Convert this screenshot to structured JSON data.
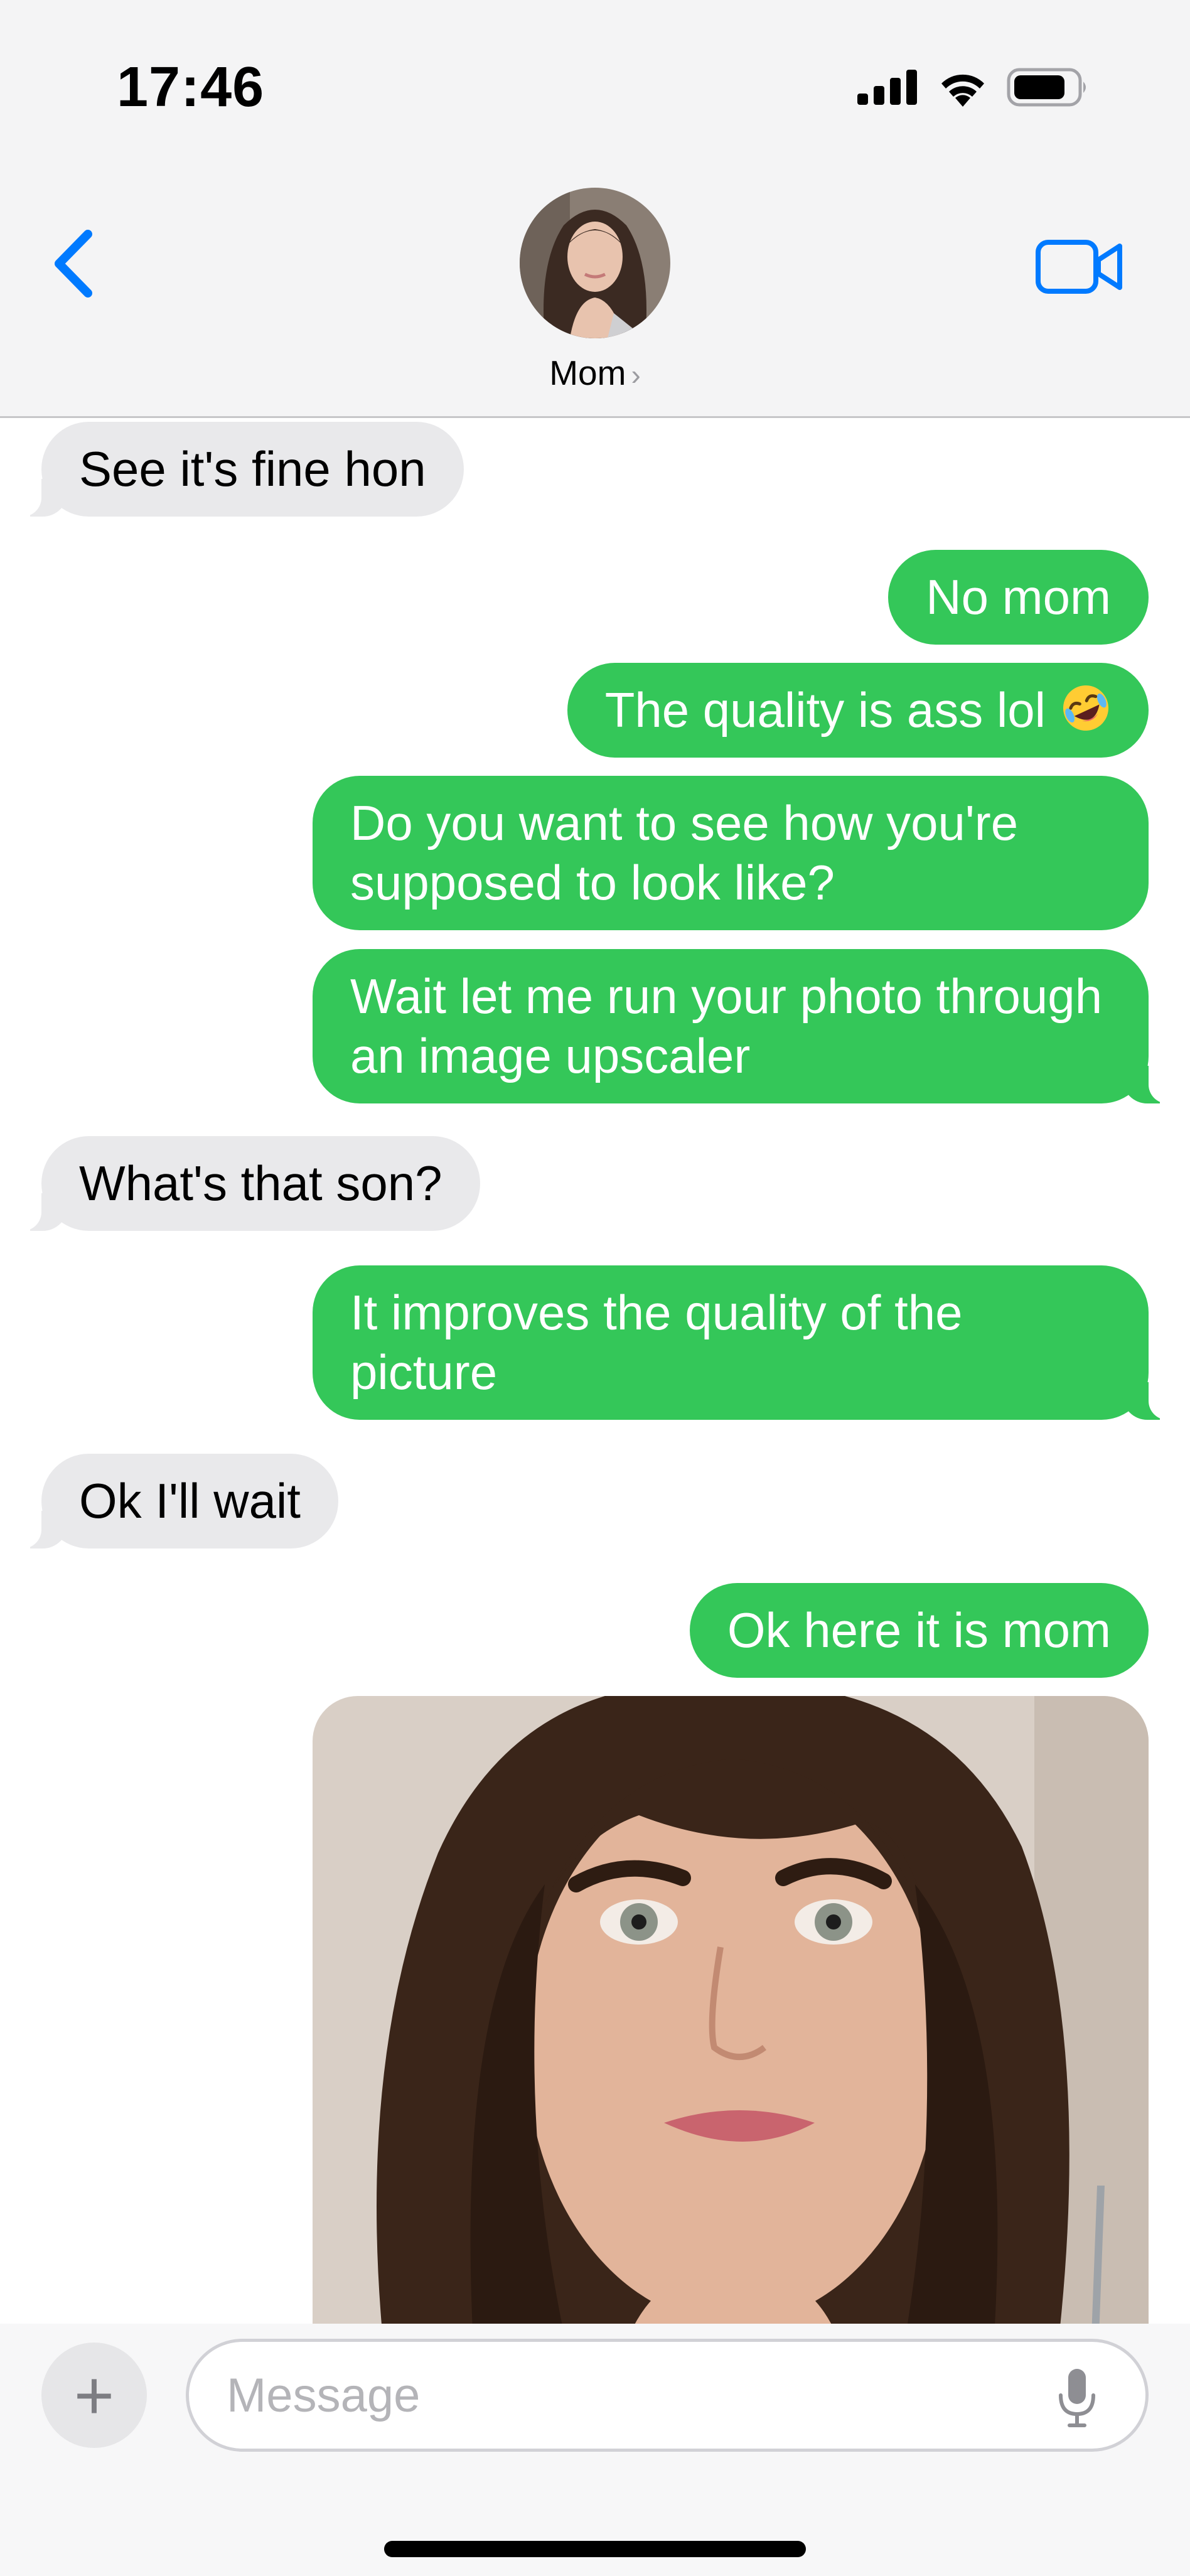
{
  "status_bar": {
    "time": "17:46"
  },
  "header": {
    "contact_name": "Mom",
    "contact_chevron": "›"
  },
  "messages": [
    {
      "direction": "incoming",
      "text": "See it's fine hon"
    },
    {
      "direction": "outgoing",
      "text": "No mom"
    },
    {
      "direction": "outgoing",
      "text": "The quality is ass lol",
      "emoji": "rolling-on-floor-laughing"
    },
    {
      "direction": "outgoing",
      "text": "Do you want to see how you're supposed to look like?"
    },
    {
      "direction": "outgoing",
      "text": "Wait let me run your photo through an image upscaler"
    },
    {
      "direction": "incoming",
      "text": "What's that son?"
    },
    {
      "direction": "outgoing",
      "text": "It improves the quality of the picture"
    },
    {
      "direction": "incoming",
      "text": "Ok I'll wait"
    },
    {
      "direction": "outgoing",
      "text": "Ok here it is mom"
    },
    {
      "direction": "outgoing",
      "type": "photo"
    }
  ],
  "composer": {
    "placeholder": "Message",
    "plus_label": "+"
  },
  "icons": {
    "back": "chevron-left-icon",
    "video": "video-camera-icon",
    "signal": "cellular-signal-icon",
    "wifi": "wifi-icon",
    "battery": "battery-icon",
    "mic": "microphone-icon"
  },
  "colors": {
    "accent": "#007aff",
    "outgoing_bubble": "#34c759",
    "incoming_bubble": "#e9e9eb"
  }
}
